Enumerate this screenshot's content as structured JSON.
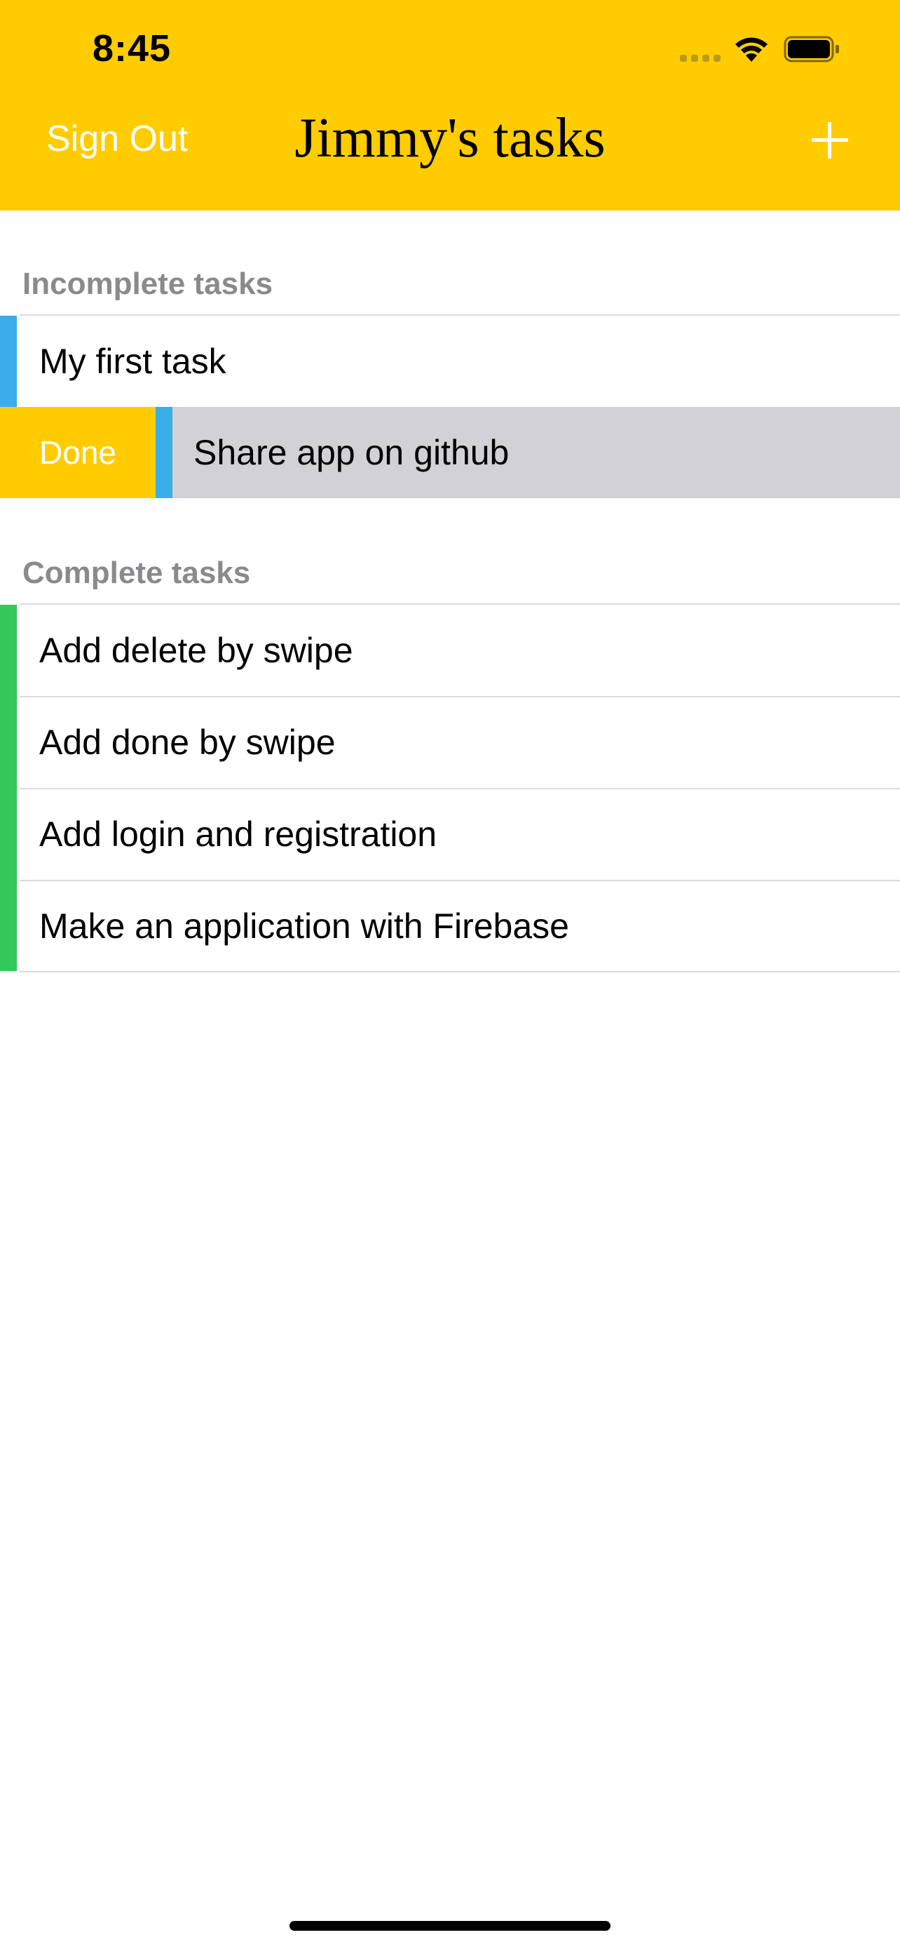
{
  "status_bar": {
    "time": "8:45",
    "signal_icon": "cellular-signal-icon",
    "wifi_icon": "wifi-icon",
    "battery_icon": "battery-icon"
  },
  "nav": {
    "left_button": "Sign Out",
    "title": "Jimmy's tasks",
    "right_icon": "plus-icon"
  },
  "sections": {
    "incomplete": {
      "header": "Incomplete tasks",
      "items": [
        "My first task",
        "Share app on github"
      ]
    },
    "complete": {
      "header": "Complete tasks",
      "items": [
        "Add delete by swipe",
        "Add done by swipe",
        "Add login and registration",
        "Make an application with Firebase"
      ]
    }
  },
  "swipe_action": {
    "label": "Done"
  },
  "colors": {
    "accent": "#FFCC00",
    "incomplete_bar": "#3aaee8",
    "complete_bar": "#34c759",
    "swiped_cell": "#d1d1d6"
  }
}
